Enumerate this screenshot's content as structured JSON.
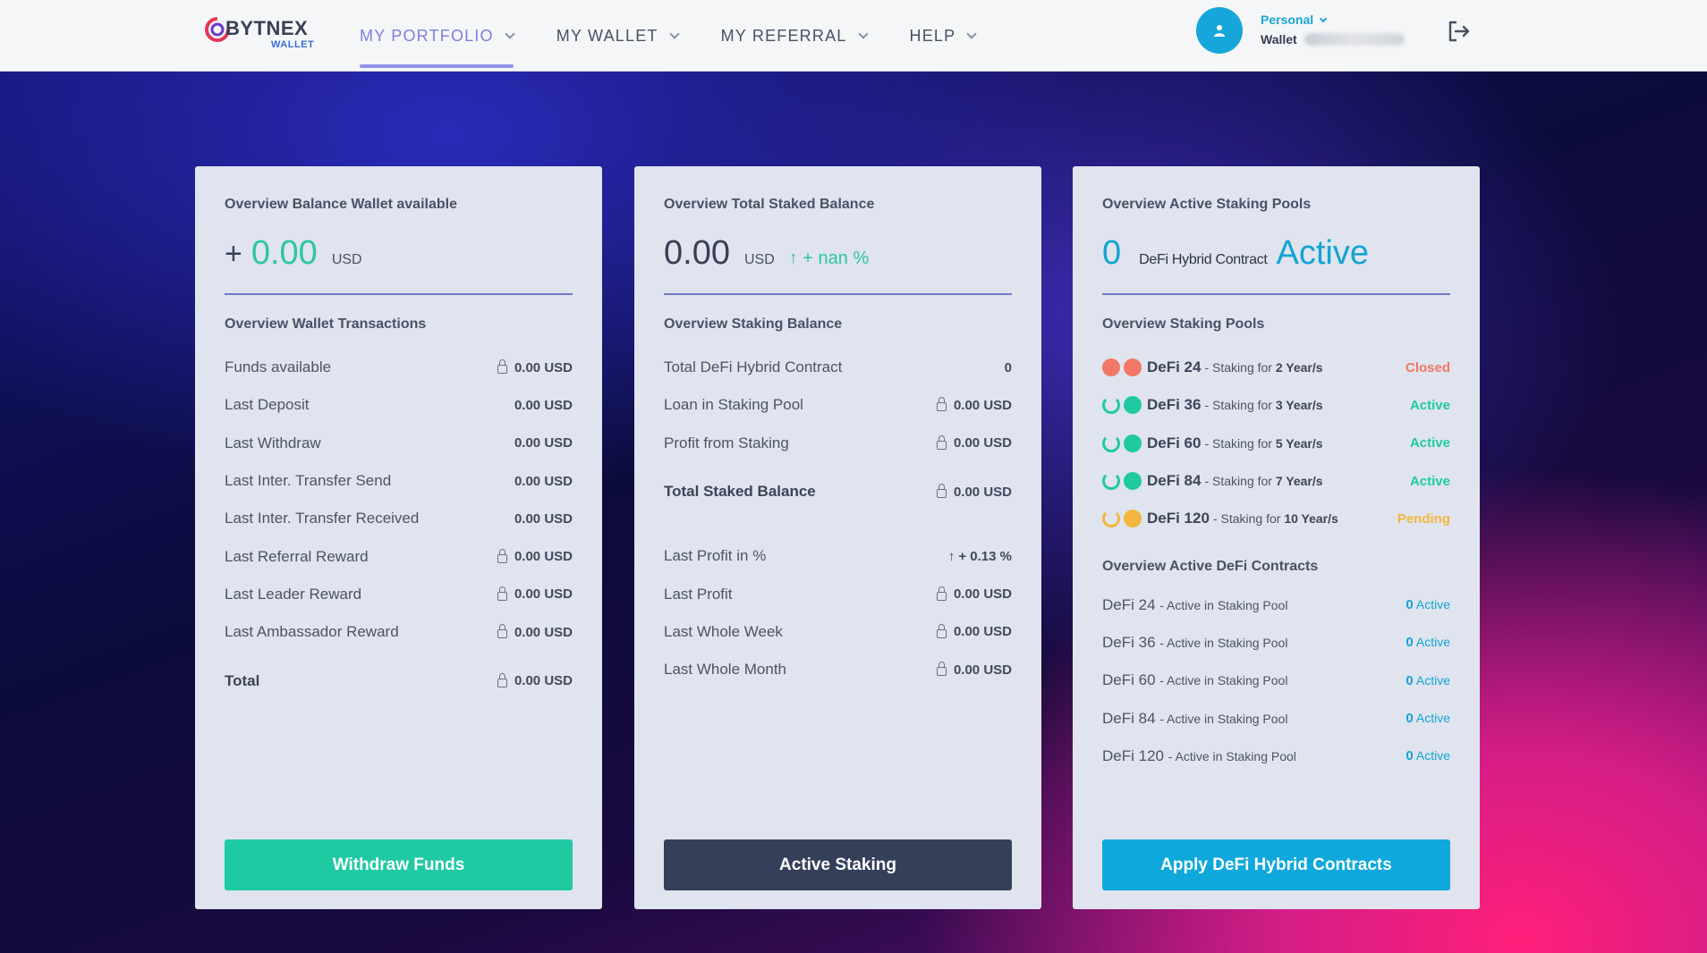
{
  "header": {
    "logo_text": "BYTNEX",
    "logo_sub": "WALLET",
    "nav": [
      {
        "label": "MY PORTFOLIO",
        "active": true
      },
      {
        "label": "MY WALLET",
        "active": false
      },
      {
        "label": "MY REFERRAL",
        "active": false
      },
      {
        "label": "HELP",
        "active": false
      }
    ],
    "account_type": "Personal",
    "account_wallet_label": "Wallet"
  },
  "colors": {
    "teal": "#1fcaa3",
    "blue": "#0ea8dd",
    "dark": "#34405a",
    "accent": "#7a7fe0",
    "closed": "#f07864",
    "pending": "#f4b63e"
  },
  "card1": {
    "title": "Overview Balance Wallet available",
    "plus": "+",
    "amount": "0.00",
    "unit": "USD",
    "section_title": "Overview Wallet Transactions",
    "rows": [
      {
        "label": "Funds available",
        "value": "0.00 USD",
        "locked": true
      },
      {
        "label": "Last Deposit",
        "value": "0.00 USD",
        "locked": false
      },
      {
        "label": "Last Withdraw",
        "value": "0.00 USD",
        "locked": false
      },
      {
        "label": "Last Inter. Transfer Send",
        "value": "0.00 USD",
        "locked": false
      },
      {
        "label": "Last Inter. Transfer Received",
        "value": "0.00 USD",
        "locked": false
      },
      {
        "label": "Last Referral Reward",
        "value": "0.00 USD",
        "locked": true
      },
      {
        "label": "Last Leader Reward",
        "value": "0.00 USD",
        "locked": true
      },
      {
        "label": "Last Ambassador Reward",
        "value": "0.00 USD",
        "locked": true
      }
    ],
    "total_label": "Total",
    "total_value": "0.00 USD",
    "button": "Withdraw Funds"
  },
  "card2": {
    "title": "Overview Total Staked Balance",
    "amount": "0.00",
    "unit": "USD",
    "change": "↑ + nan %",
    "section_title": "Overview Staking Balance",
    "rows": [
      {
        "label": "Total DeFi Hybrid Contract",
        "value": "0",
        "locked": false
      },
      {
        "label": "Loan in Staking Pool",
        "value": "0.00 USD",
        "locked": true
      },
      {
        "label": "Profit from Staking",
        "value": "0.00 USD",
        "locked": true
      }
    ],
    "total_label": "Total Staked Balance",
    "total_value": "0.00 USD",
    "rows2": [
      {
        "label": "Last Profit in %",
        "value": "↑ + 0.13 %",
        "green": true
      },
      {
        "label": "Last Profit",
        "value": "0.00 USD",
        "locked": true
      },
      {
        "label": "Last Whole Week",
        "value": "0.00 USD",
        "locked": true
      },
      {
        "label": "Last Whole Month",
        "value": "0.00 USD",
        "locked": true
      }
    ],
    "button": "Active Staking"
  },
  "card3": {
    "title": "Overview Active Staking Pools",
    "count": "0",
    "label": "DeFi Hybrid Contract",
    "state": "Active",
    "section_title": "Overview Staking Pools",
    "pools": [
      {
        "name": "DeFi 24",
        "desc": "- Staking for",
        "years": "2 Year/s",
        "status": "Closed",
        "kind": "closed"
      },
      {
        "name": "DeFi 36",
        "desc": "- Staking for",
        "years": "3 Year/s",
        "status": "Active",
        "kind": "active"
      },
      {
        "name": "DeFi 60",
        "desc": "- Staking for",
        "years": "5 Year/s",
        "status": "Active",
        "kind": "active"
      },
      {
        "name": "DeFi 84",
        "desc": "- Staking for",
        "years": "7 Year/s",
        "status": "Active",
        "kind": "active"
      },
      {
        "name": "DeFi 120",
        "desc": "- Staking for",
        "years": "10 Year/s",
        "status": "Pending",
        "kind": "pending"
      }
    ],
    "contracts_title": "Overview Active DeFi Contracts",
    "contracts": [
      {
        "name": "DeFi 24",
        "desc": "- Active in Staking Pool",
        "count": "0",
        "state": "Active"
      },
      {
        "name": "DeFi 36",
        "desc": "- Active in Staking Pool",
        "count": "0",
        "state": "Active"
      },
      {
        "name": "DeFi 60",
        "desc": "- Active in Staking Pool",
        "count": "0",
        "state": "Active"
      },
      {
        "name": "DeFi 84",
        "desc": "- Active in Staking Pool",
        "count": "0",
        "state": "Active"
      },
      {
        "name": "DeFi 120",
        "desc": "- Active in Staking Pool",
        "count": "0",
        "state": "Active"
      }
    ],
    "button": "Apply DeFi Hybrid Contracts"
  }
}
